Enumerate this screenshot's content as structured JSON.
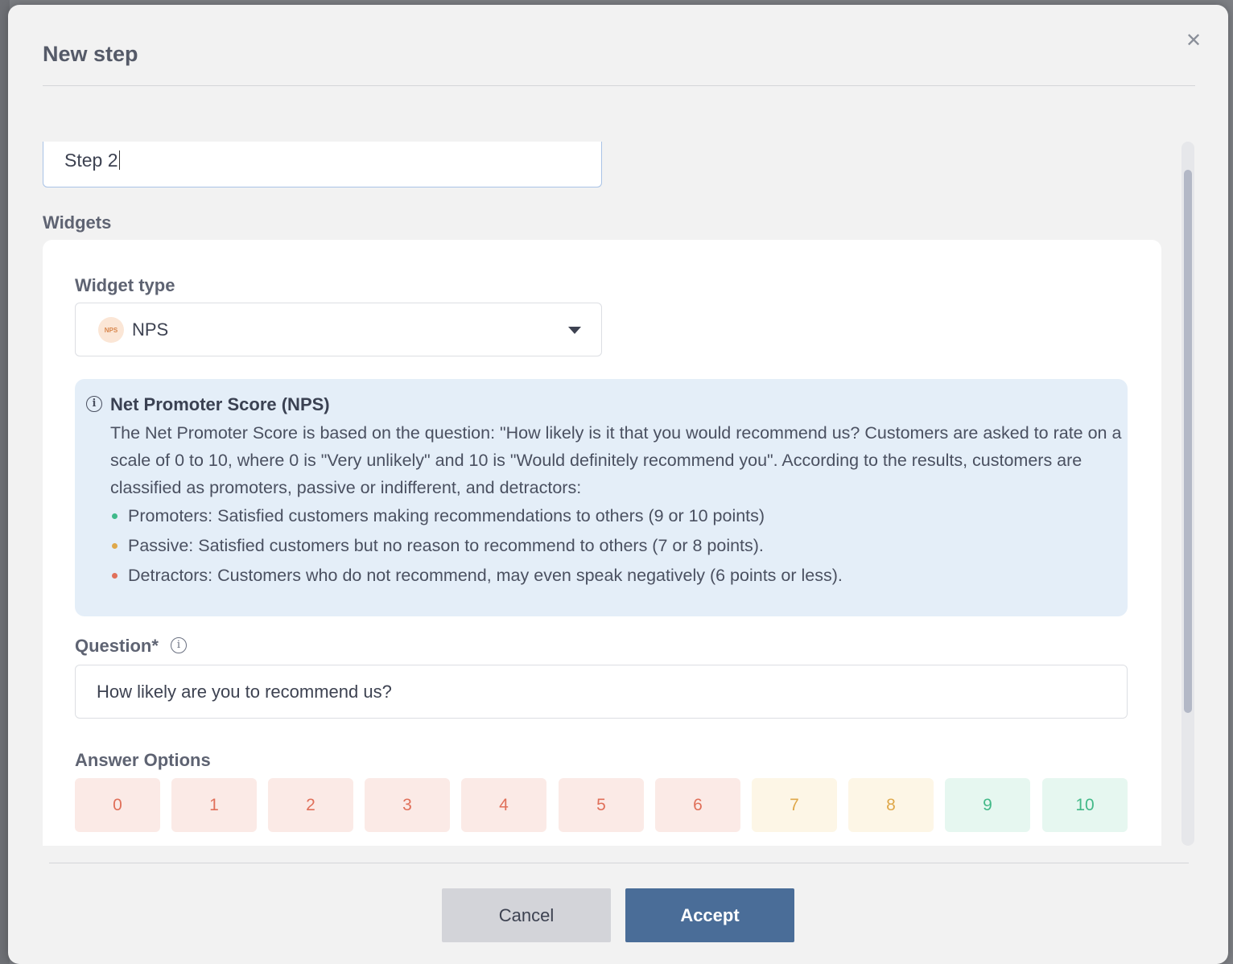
{
  "modal": {
    "title": "New step",
    "close_icon": "close-icon"
  },
  "step": {
    "name_value": "Step 2"
  },
  "widgets": {
    "section_label": "Widgets",
    "widget_type_label": "Widget type",
    "widget_type_value": "NPS",
    "widget_type_badge": "NPS",
    "info": {
      "title": "Net Promoter Score (NPS)",
      "paragraph": "The Net Promoter Score is based on the question: \"How likely is it that you would recommend us? Customers are asked to rate on a scale of 0 to 10, where 0 is \"Very unlikely\" and 10 is \"Would definitely recommend you\". According to the results, customers are classified as promoters, passive or indifferent, and detractors:",
      "bullets": [
        {
          "text": "Promoters: Satisfied customers making recommendations to others (9 or 10 points)",
          "color": "#3fb98a"
        },
        {
          "text": "Passive: Satisfied customers but no reason to recommend to others (7 or 8 points).",
          "color": "#dfa84a"
        },
        {
          "text": "Detractors: Customers who do not recommend, may even speak negatively (6 points or less).",
          "color": "#e0705a"
        }
      ]
    },
    "question_label": "Question*",
    "question_value": "How likely are you to recommend us?",
    "answers_label": "Answer Options",
    "answers": [
      "0",
      "1",
      "2",
      "3",
      "4",
      "5",
      "6",
      "7",
      "8",
      "9",
      "10"
    ]
  },
  "footer": {
    "cancel_label": "Cancel",
    "accept_label": "Accept"
  },
  "colors": {
    "accent": "#4a6d98",
    "detractor": "#e0705a",
    "passive": "#dfa84a",
    "promoter": "#43b988"
  }
}
